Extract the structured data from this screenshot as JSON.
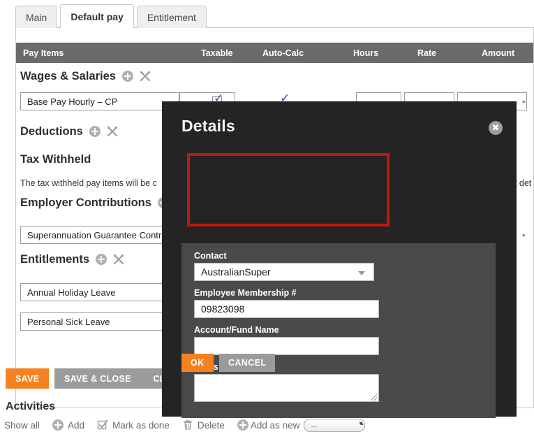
{
  "tabs": [
    {
      "label": "Main",
      "active": false
    },
    {
      "label": "Default pay",
      "active": true
    },
    {
      "label": "Entitlement",
      "active": false
    }
  ],
  "table_header": {
    "pay_items": "Pay Items",
    "taxable": "Taxable",
    "auto_calc": "Auto-Calc",
    "hours": "Hours",
    "rate": "Rate",
    "amount": "Amount"
  },
  "sections": {
    "wages": "Wages & Salaries",
    "deductions": "Deductions",
    "tax_withheld": "Tax Withheld",
    "employer_contributions": "Employer Contributions",
    "entitlements": "Entitlements"
  },
  "rows": {
    "base_pay": "Base Pay Hourly – CP",
    "super_guarantee": "Superannuation Guarantee Contri",
    "annual_holiday": "Annual Holiday Leave",
    "personal_sick": "Personal Sick Leave"
  },
  "tax_note": "The tax withheld pay items will be c",
  "tax_note_right": "nt det",
  "buttons": {
    "save": "SAVE",
    "save_and_close": "SAVE & CLOSE",
    "close": "CLO"
  },
  "activities": {
    "title": "Activities",
    "show_all": "Show all",
    "add": "Add",
    "mark_as_done": "Mark as done",
    "delete": "Delete",
    "add_as_new": "Add as new",
    "select_value": "..."
  },
  "modal": {
    "title": "Details",
    "close_icon": "✖",
    "fields": {
      "contact_label": "Contact",
      "contact_value": "AustralianSuper",
      "membership_label": "Employee Membership #",
      "membership_value": "09823098",
      "account_label": "Account/Fund Name",
      "account_value": "",
      "notes_label": "Notes",
      "notes_value": ""
    },
    "ok": "OK",
    "cancel": "CANCEL"
  },
  "colors": {
    "accent_orange": "#f58220",
    "modal_bg": "#242424",
    "modal_panel": "#4a4a4a",
    "table_header": "#6a6a6a",
    "highlight_red": "#c0170c"
  }
}
